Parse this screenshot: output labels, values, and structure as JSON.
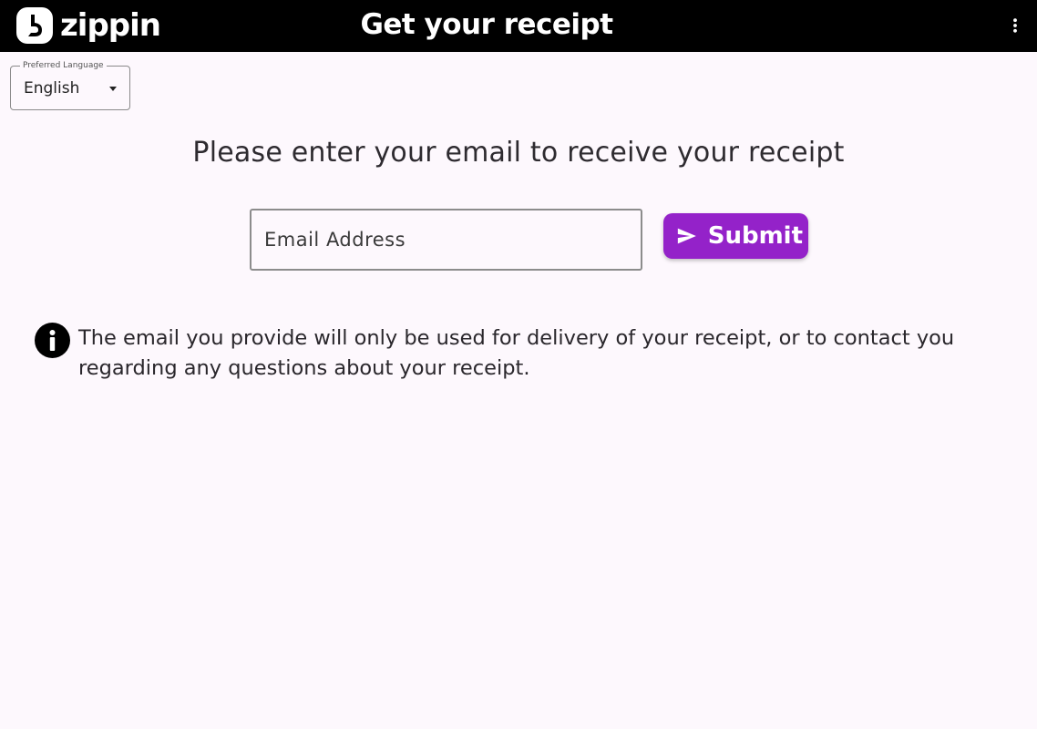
{
  "header": {
    "brand": "zippin",
    "title": "Get your receipt",
    "menu_icon": "more-vertical-icon",
    "logo_icon": "zippin-logo-icon"
  },
  "language": {
    "label": "Preferred Language",
    "selected": "English",
    "caret_icon": "dropdown-caret-icon"
  },
  "main": {
    "prompt": "Please enter your email to receive your receipt",
    "email_placeholder": "Email Address",
    "email_value": "",
    "submit_label": "Submit",
    "submit_icon": "send-icon",
    "notice_icon": "info-icon",
    "notice": "The email you provide will only be used for delivery of your receipt, or to contact you regarding any questions about your receipt."
  },
  "colors": {
    "topbar": "#000000",
    "accent": "#9422c9",
    "background": "#fdf8fd"
  }
}
